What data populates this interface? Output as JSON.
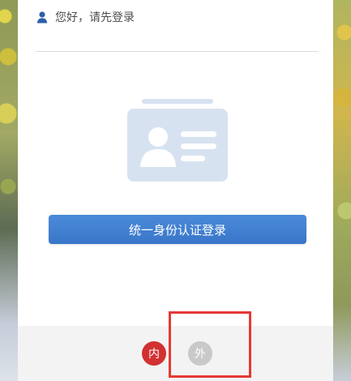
{
  "header": {
    "greeting": "您好，请先登录",
    "user_icon": "user-icon"
  },
  "main": {
    "login_button_label": "统一身份认证登录",
    "id_card_icon": "id-card-icon"
  },
  "footer": {
    "inner_network_label": "内",
    "outer_network_label": "外"
  },
  "colors": {
    "accent_blue": "#3b7dd8",
    "inner_red": "#d23131",
    "outer_gray": "#c9c9c9",
    "highlight_red": "#e53935"
  }
}
